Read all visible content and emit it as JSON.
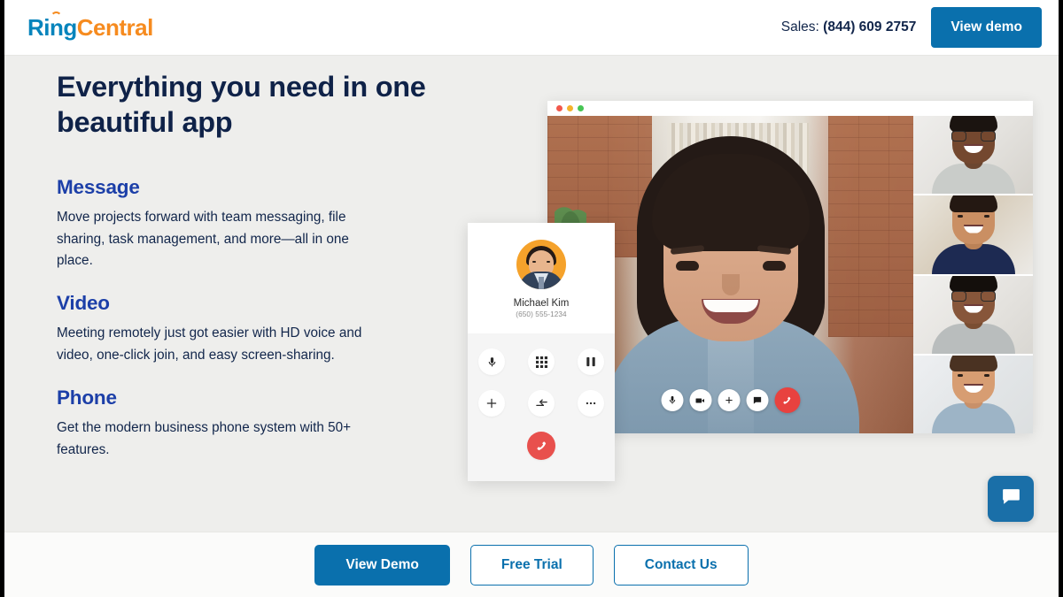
{
  "header": {
    "logo": {
      "part1": "Ring",
      "part2": "Central",
      "color1": "#0684bc",
      "color2": "#f68b1f"
    },
    "sales_label": "Sales:",
    "sales_number": "(844) 609 2757",
    "view_demo_label": "View demo"
  },
  "hero": {
    "title": "Everything you need in one beautiful app",
    "features": [
      {
        "title": "Message",
        "body": "Move projects forward with team messaging, file sharing, task management, and more—all in one place."
      },
      {
        "title": "Video",
        "body": "Meeting remotely just got easier with HD voice and video, one-click join, and easy screen-sharing."
      },
      {
        "title": "Phone",
        "body": "Get the modern business phone system with 50+ features."
      }
    ],
    "heading_color": "#1c3fa8",
    "text_color": "#12264b"
  },
  "phone_card": {
    "contact_name": "Michael Kim",
    "contact_number": "(650) 555-1234",
    "controls": [
      {
        "icon": "microphone-icon",
        "label": "Mute"
      },
      {
        "icon": "keypad-icon",
        "label": "Keypad"
      },
      {
        "icon": "pause-icon",
        "label": "Hold"
      },
      {
        "icon": "plus-icon",
        "label": "Add call"
      },
      {
        "icon": "transfer-icon",
        "label": "Transfer"
      },
      {
        "icon": "more-icon",
        "label": "More"
      }
    ],
    "end_call": {
      "icon": "hangup-icon",
      "label": "End call",
      "color": "#e8504d"
    }
  },
  "video_window": {
    "traffic_lights": [
      "#f2574b",
      "#f5b32c",
      "#46c554"
    ],
    "controls": [
      {
        "icon": "microphone-icon",
        "label": "Mute"
      },
      {
        "icon": "camera-icon",
        "label": "Stop video"
      },
      {
        "icon": "plus-icon",
        "label": "Invite"
      },
      {
        "icon": "chat-icon",
        "label": "Chat"
      },
      {
        "icon": "hangup-icon",
        "label": "Leave meeting"
      }
    ],
    "participant_count": 4
  },
  "footer": {
    "buttons": [
      {
        "label": "View Demo",
        "style": "primary"
      },
      {
        "label": "Free Trial",
        "style": "secondary"
      },
      {
        "label": "Contact Us",
        "style": "secondary"
      }
    ],
    "accent_color": "#0a70ad"
  },
  "chat_widget": {
    "icon": "chat-bubble-icon",
    "label": "Chat",
    "color": "#1a6fa8"
  }
}
